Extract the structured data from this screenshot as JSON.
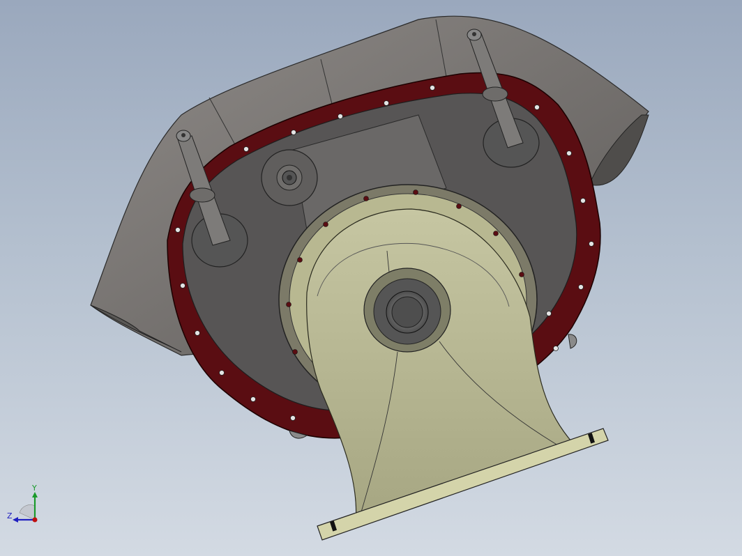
{
  "viewport": {
    "background_top": "#9aa8bd",
    "background_bottom": "#d3dae3"
  },
  "model": {
    "housing_color": "#6f6c6a",
    "housing_light": "#8e8a87",
    "gasket_color": "#5a0d12",
    "duct_color": "#b3b38e",
    "duct_shadow": "#8e8e6c"
  },
  "triad": {
    "y_label": "Y",
    "z_label": "Z",
    "y_color": "#1a9a2a",
    "z_color": "#2020c0",
    "x_color": "#c01010"
  }
}
